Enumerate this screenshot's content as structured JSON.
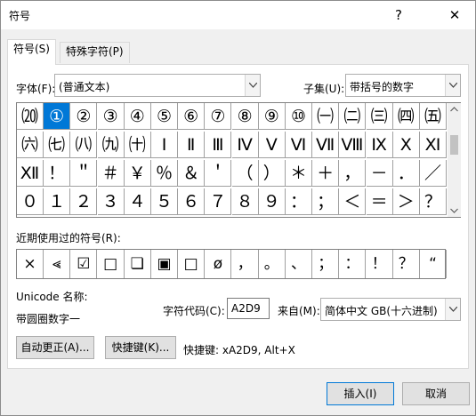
{
  "window": {
    "title": "符号",
    "help": "?",
    "close": "✕"
  },
  "tabs": [
    {
      "label": "符号(S)"
    },
    {
      "label": "特殊字符(P)"
    }
  ],
  "font": {
    "label": "字体(F):",
    "value": "(普通文本)"
  },
  "subset": {
    "label": "子集(U):",
    "value": "带括号的数字"
  },
  "symbol_grid": {
    "rows": [
      [
        "⒇",
        "①",
        "②",
        "③",
        "④",
        "⑤",
        "⑥",
        "⑦",
        "⑧",
        "⑨",
        "⑩",
        "㈠",
        "㈡",
        "㈢",
        "㈣",
        "㈤"
      ],
      [
        "㈥",
        "㈦",
        "㈧",
        "㈨",
        "㈩",
        "Ⅰ",
        "Ⅱ",
        "Ⅲ",
        "Ⅳ",
        "Ⅴ",
        "Ⅵ",
        "Ⅶ",
        "Ⅷ",
        "Ⅸ",
        "Ⅹ",
        "Ⅺ"
      ],
      [
        "Ⅻ",
        "！",
        "＂",
        "＃",
        "￥",
        "％",
        "＆",
        "＇",
        "（",
        "）",
        "＊",
        "＋",
        "，",
        "－",
        "．",
        "／"
      ],
      [
        "０",
        "１",
        "２",
        "３",
        "４",
        "５",
        "６",
        "７",
        "８",
        "９",
        "：",
        "；",
        "＜",
        "＝",
        "＞",
        "？"
      ]
    ],
    "selected": "①"
  },
  "recent": {
    "label": "近期使用过的符号(R):",
    "symbols": [
      "×",
      "⪡",
      "☑",
      "□",
      "❏",
      "▣",
      "□",
      "ø",
      "，",
      "。",
      "、",
      "；",
      "：",
      "！",
      "？",
      "“"
    ]
  },
  "unicode": {
    "label": "Unicode 名称:",
    "name": "带圆圈数字一"
  },
  "char_code": {
    "label": "字符代码(C):",
    "value": "A2D9"
  },
  "from": {
    "label": "来自(M):",
    "value": "简体中文 GB(十六进制)"
  },
  "buttons": {
    "autocorrect": "自动更正(A)...",
    "shortcut_key": "快捷键(K)...",
    "insert": "插入(I)",
    "cancel": "取消"
  },
  "shortcut": {
    "text": "快捷键: xA2D9, Alt+X"
  }
}
